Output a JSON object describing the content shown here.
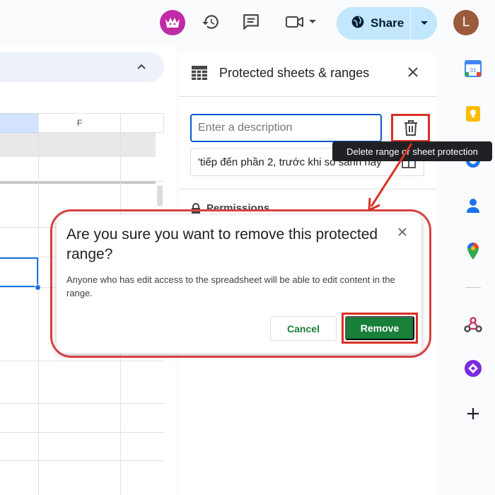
{
  "topbar": {
    "share_label": "Share",
    "user_initial": "L",
    "icons": [
      "extension-avatar-icon",
      "version-history-icon",
      "comments-icon",
      "meet-icon",
      "globe-icon",
      "chevron-down-icon"
    ]
  },
  "sheet": {
    "column_label_f": "F"
  },
  "panel": {
    "title": "Protected sheets & ranges",
    "description_placeholder": "Enter a description",
    "range_value": "'tiếp đến phần 2, trước khi so sánh hay",
    "permissions_label": "Permissions"
  },
  "tooltip": {
    "text": "Delete range or sheet protection"
  },
  "dialog": {
    "title": "Are you sure you want to remove this protected range?",
    "body": "Anyone who has edit access to the spreadsheet will be able to edit content in the range.",
    "cancel_label": "Cancel",
    "remove_label": "Remove"
  },
  "rail": {
    "icons": [
      "calendar-icon",
      "keep-icon",
      "tasks-icon",
      "contacts-icon",
      "maps-icon",
      "webhook-icon",
      "addon-icon",
      "add-icon"
    ],
    "calendar_day": "31"
  },
  "colors": {
    "accent_blue": "#0b57d0",
    "share_bg": "#c2e7ff",
    "remove_green": "#188038",
    "annotation_red": "#d93025"
  }
}
